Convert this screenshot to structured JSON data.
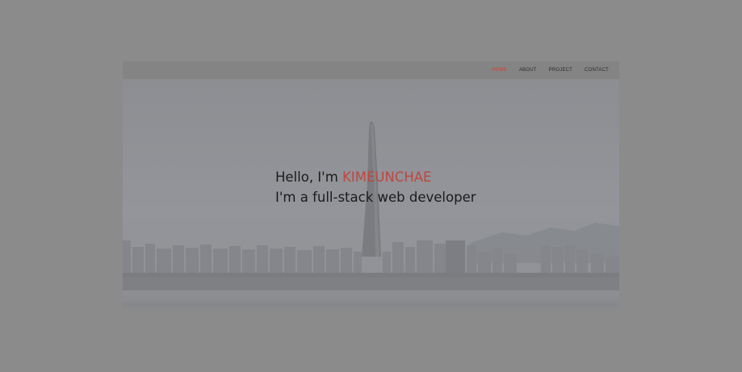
{
  "nav": {
    "items": [
      {
        "label": "HOME",
        "active": true
      },
      {
        "label": "ABOUT",
        "active": false
      },
      {
        "label": "PROJECT",
        "active": false
      },
      {
        "label": "CONTACT",
        "active": false
      }
    ]
  },
  "hero": {
    "greeting_prefix": "Hello, I'm",
    "name": "KIMEUNCHAE",
    "tagline": "I'm a full-stack web developer"
  },
  "colors": {
    "accent": "#c0463f",
    "overlay": "#8b8b8b"
  }
}
